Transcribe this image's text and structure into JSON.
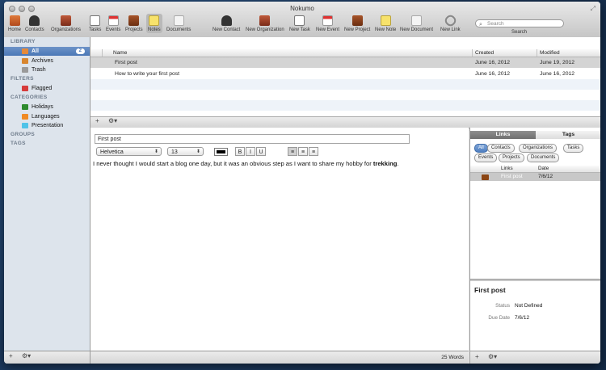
{
  "window": {
    "title": "Nokumo"
  },
  "toolbar": {
    "items": [
      {
        "label": "Home",
        "icon": "home-icon"
      },
      {
        "label": "Contacts",
        "icon": "contacts-icon"
      },
      {
        "label": "Organizations",
        "icon": "organizations-icon"
      },
      {
        "label": "Tasks",
        "icon": "tasks-icon"
      },
      {
        "label": "Events",
        "icon": "events-icon"
      },
      {
        "label": "Projects",
        "icon": "projects-icon"
      },
      {
        "label": "Notes",
        "icon": "notes-icon"
      },
      {
        "label": "Documents",
        "icon": "documents-icon"
      },
      {
        "label": "New Contact",
        "icon": "new-contact-icon"
      },
      {
        "label": "New Organization",
        "icon": "new-organization-icon"
      },
      {
        "label": "New Task",
        "icon": "new-task-icon"
      },
      {
        "label": "New Event",
        "icon": "new-event-icon"
      },
      {
        "label": "New Project",
        "icon": "new-project-icon"
      },
      {
        "label": "New Note",
        "icon": "new-note-icon"
      },
      {
        "label": "New Document",
        "icon": "new-document-icon"
      },
      {
        "label": "New Link",
        "icon": "new-link-icon"
      }
    ],
    "selected": "Notes",
    "search_placeholder": "Search",
    "search_label": "Search"
  },
  "sidebar": {
    "library_heading": "LIBRARY",
    "library": [
      {
        "label": "All",
        "badge": "2",
        "icon": "all-notes-icon",
        "selected": true
      },
      {
        "label": "Archives",
        "icon": "archives-icon"
      },
      {
        "label": "Trash",
        "icon": "trash-icon"
      }
    ],
    "filters_heading": "FILTERS",
    "filters": [
      {
        "label": "Flagged",
        "icon": "flag-icon"
      }
    ],
    "categories_heading": "CATEGORIES",
    "categories": [
      {
        "label": "Holidays",
        "color": "#2e8b2e"
      },
      {
        "label": "Languages",
        "color": "#f08a24"
      },
      {
        "label": "Presentation",
        "color": "#4fc3e8"
      }
    ],
    "groups_heading": "GROUPS",
    "tags_heading": "TAGS"
  },
  "notes_list": {
    "columns": [
      "Name",
      "Created",
      "Modified"
    ],
    "rows": [
      {
        "name": "First post",
        "created": "June 16, 2012",
        "modified": "June 19, 2012",
        "selected": true
      },
      {
        "name": "How to write your first post",
        "created": "June 16, 2012",
        "modified": "June 16, 2012"
      }
    ]
  },
  "editor": {
    "title": "First post",
    "font": "Helvetica",
    "size": "13",
    "bold_label": "B",
    "italic_label": "I",
    "underline_label": "U",
    "body_plain": "I never thought I would start a blog one day, but it was an obvious step as I want to share my hobby for ",
    "body_bold": "trekking",
    "body_end": ".",
    "word_count": "25 Words"
  },
  "right_panel": {
    "tabs": [
      "Links",
      "Tags"
    ],
    "active_tab": "Links",
    "filters": [
      "All",
      "Contacts",
      "Organizations",
      "Tasks",
      "Events",
      "Projects",
      "Documents"
    ],
    "link_columns": [
      "Links",
      "Date"
    ],
    "links": [
      {
        "name": "First post",
        "date": "7/6/12"
      }
    ],
    "info": {
      "title": "First post",
      "status_label": "Status",
      "status_value": "Not Defined",
      "due_label": "Due Date",
      "due_value": "7/6/12"
    }
  }
}
